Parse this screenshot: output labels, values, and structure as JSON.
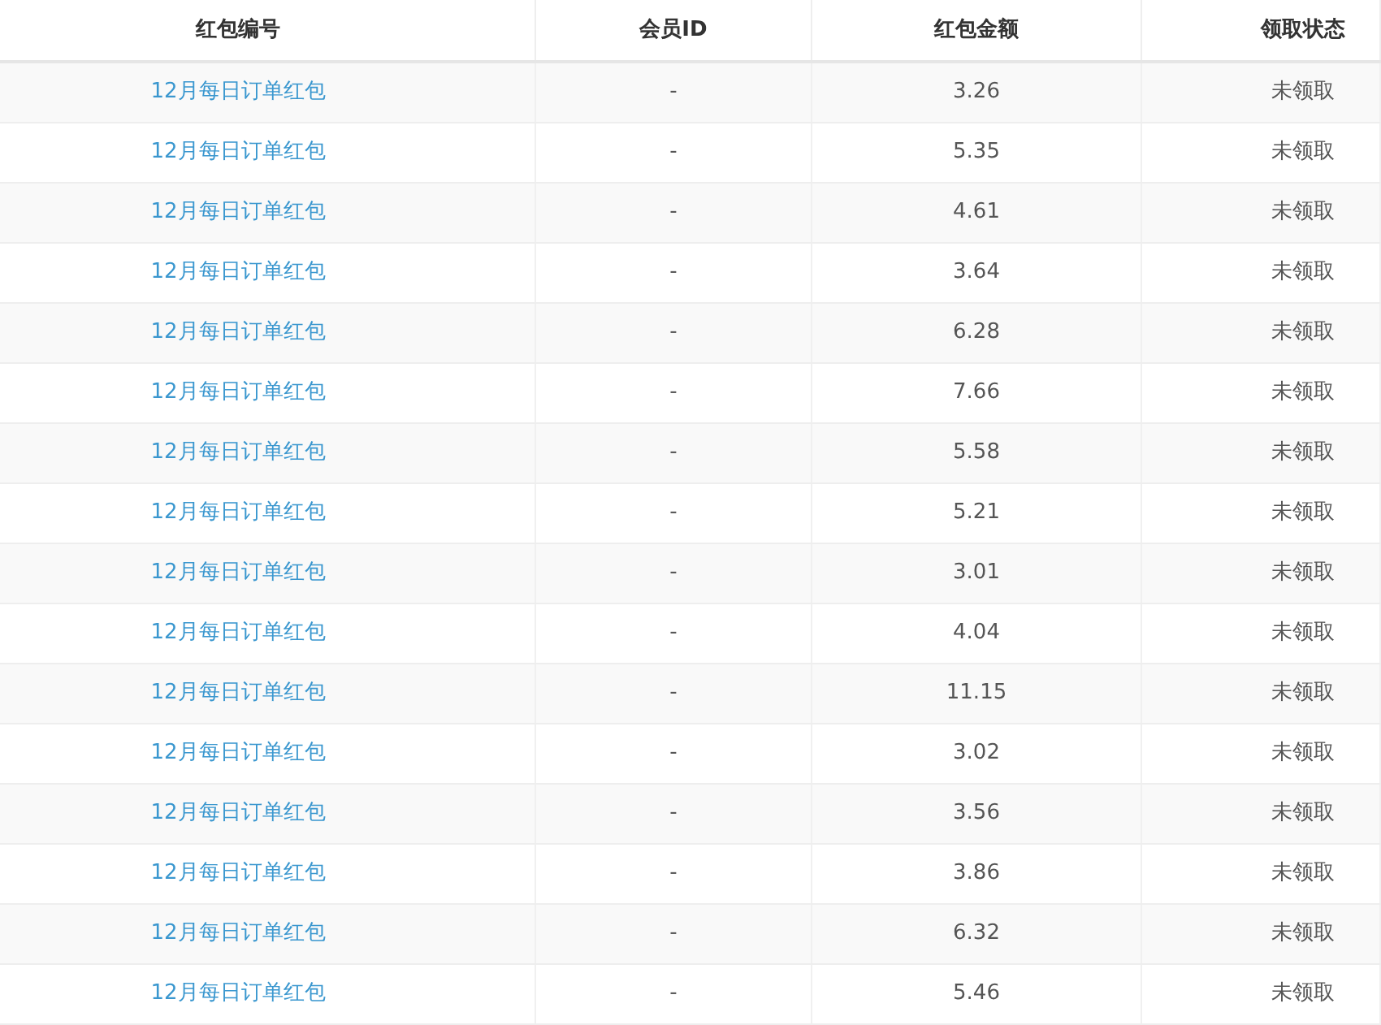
{
  "table": {
    "columns": [
      "红包编号",
      "会员ID",
      "红包金额",
      "领取状态"
    ],
    "rows": [
      {
        "name": "12月每日订单红包",
        "member_id": "-",
        "amount": "3.26",
        "status": "未领取"
      },
      {
        "name": "12月每日订单红包",
        "member_id": "-",
        "amount": "5.35",
        "status": "未领取"
      },
      {
        "name": "12月每日订单红包",
        "member_id": "-",
        "amount": "4.61",
        "status": "未领取"
      },
      {
        "name": "12月每日订单红包",
        "member_id": "-",
        "amount": "3.64",
        "status": "未领取"
      },
      {
        "name": "12月每日订单红包",
        "member_id": "-",
        "amount": "6.28",
        "status": "未领取"
      },
      {
        "name": "12月每日订单红包",
        "member_id": "-",
        "amount": "7.66",
        "status": "未领取"
      },
      {
        "name": "12月每日订单红包",
        "member_id": "-",
        "amount": "5.58",
        "status": "未领取"
      },
      {
        "name": "12月每日订单红包",
        "member_id": "-",
        "amount": "5.21",
        "status": "未领取"
      },
      {
        "name": "12月每日订单红包",
        "member_id": "-",
        "amount": "3.01",
        "status": "未领取"
      },
      {
        "name": "12月每日订单红包",
        "member_id": "-",
        "amount": "4.04",
        "status": "未领取"
      },
      {
        "name": "12月每日订单红包",
        "member_id": "-",
        "amount": "11.15",
        "status": "未领取"
      },
      {
        "name": "12月每日订单红包",
        "member_id": "-",
        "amount": "3.02",
        "status": "未领取"
      },
      {
        "name": "12月每日订单红包",
        "member_id": "-",
        "amount": "3.56",
        "status": "未领取"
      },
      {
        "name": "12月每日订单红包",
        "member_id": "-",
        "amount": "3.86",
        "status": "未领取"
      },
      {
        "name": "12月每日订单红包",
        "member_id": "-",
        "amount": "6.32",
        "status": "未领取"
      },
      {
        "name": "12月每日订单红包",
        "member_id": "-",
        "amount": "5.46",
        "status": "未领取"
      }
    ]
  }
}
